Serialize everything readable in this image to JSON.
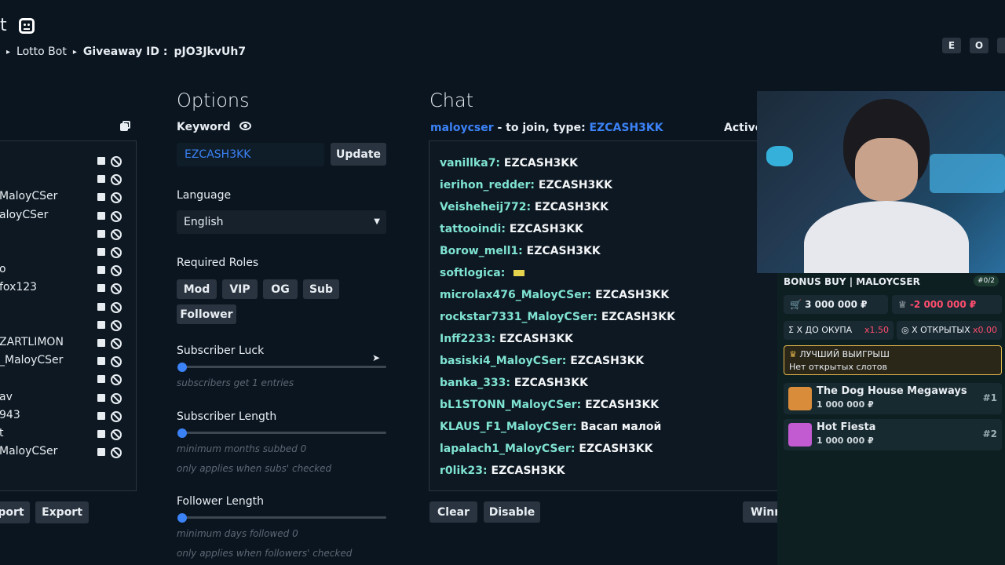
{
  "header": {
    "logo_fragment": "t",
    "breadcrumb": [
      {
        "label": "Lotto Bot"
      },
      {
        "label": "Giveaway ID :"
      }
    ],
    "giveaway_id": "pJO3JkvUh7",
    "top_buttons": [
      "E",
      "O"
    ]
  },
  "entries_list": {
    "names": [
      "",
      "",
      "MaloyCSer",
      "aloyCSer",
      "",
      "",
      "o",
      "fox123",
      "",
      "",
      "ZARTLIMON",
      "_MaloyCSer",
      "",
      "av",
      "943",
      "t",
      "MaloyCSer"
    ],
    "import_label": "port",
    "export_label": "Export"
  },
  "options": {
    "title": "Options",
    "keyword_label": "Keyword",
    "keyword_value": "EZCASH3KK",
    "update_label": "Update",
    "language_label": "Language",
    "language_value": "English",
    "roles_label": "Required Roles",
    "roles": [
      "Mod",
      "VIP",
      "OG",
      "Sub",
      "Follower"
    ],
    "subscriber_luck_label": "Subscriber Luck",
    "subscriber_luck_note": "subscribers get 1 entries",
    "subscriber_length_label": "Subscriber Length",
    "subscriber_length_note": "minimum months subbed 0",
    "subscriber_length_note2": "only applies when subs' checked",
    "follower_length_label": "Follower Length",
    "follower_length_note": "minimum days followed 0",
    "follower_length_note2": "only applies when followers' checked",
    "slider_values": {
      "subscriber_luck": 0,
      "subscriber_length": 0,
      "follower_length": 0
    }
  },
  "chat": {
    "title": "Chat",
    "join_user": "maloycser",
    "join_text": " - to join, type: ",
    "join_keyword": "EZCASH3KK",
    "active_label": "Active",
    "messages": [
      {
        "user": "vanillka7:",
        "msg": "EZCASH3KK"
      },
      {
        "user": "ierihon_redder:",
        "msg": "EZCASH3KK"
      },
      {
        "user": "Veisheheij772:",
        "msg": "EZCASH3KK"
      },
      {
        "user": "tattooindi:",
        "msg": "EZCASH3KK"
      },
      {
        "user": "Borow_mell1:",
        "msg": "EZCASH3KK"
      },
      {
        "user": "softlogica:",
        "msg": ""
      },
      {
        "user": "microlax476_MaloyCSer:",
        "msg": "EZCASH3KK"
      },
      {
        "user": "rockstar7331_MaloyCSer:",
        "msg": "EZCASH3KK"
      },
      {
        "user": "Inff2233:",
        "msg": "EZCASH3KK"
      },
      {
        "user": "basiski4_MaloyCSer:",
        "msg": "EZCASH3KK"
      },
      {
        "user": "banka_333:",
        "msg": "EZCASH3KK"
      },
      {
        "user": "bL1STONN_MaloyCSer:",
        "msg": "EZCASH3KK"
      },
      {
        "user": "KLAUS_F1_MaloyCSer:",
        "msg": "Васап малой"
      },
      {
        "user": "lapalach1_MaloyCSer:",
        "msg": "EZCASH3KK"
      },
      {
        "user": "r0lik23:",
        "msg": "EZCASH3KK"
      }
    ],
    "clear_label": "Clear",
    "disable_label": "Disable",
    "winner_label": "Winn"
  },
  "bonus_overlay": {
    "title": "BONUS BUY | MALOYCSER",
    "counter": "#0/2",
    "cost": "3 000 000 ₽",
    "profit": "-2 000 000 ₽",
    "payback_label": "Х ДО ОКУПА",
    "payback_value": "x1.50",
    "open_label": "Х ОТКРЫТЫХ",
    "open_value": "x0.00",
    "best_win_label": "ЛУЧШИЙ ВЫИГРЫШ",
    "best_win_text": "Нет открытых слотов",
    "slots": [
      {
        "name": "The Dog House Megaways",
        "price": "1 000 000 ₽",
        "rank": "#1"
      },
      {
        "name": "Hot Fiesta",
        "price": "1 000 000 ₽",
        "rank": "#2"
      }
    ]
  },
  "colors": {
    "accent": "#3b82f6",
    "chat_user": "#7fe3d2",
    "profit_negative": "#ff4d6d",
    "gold": "#e5b94e"
  }
}
